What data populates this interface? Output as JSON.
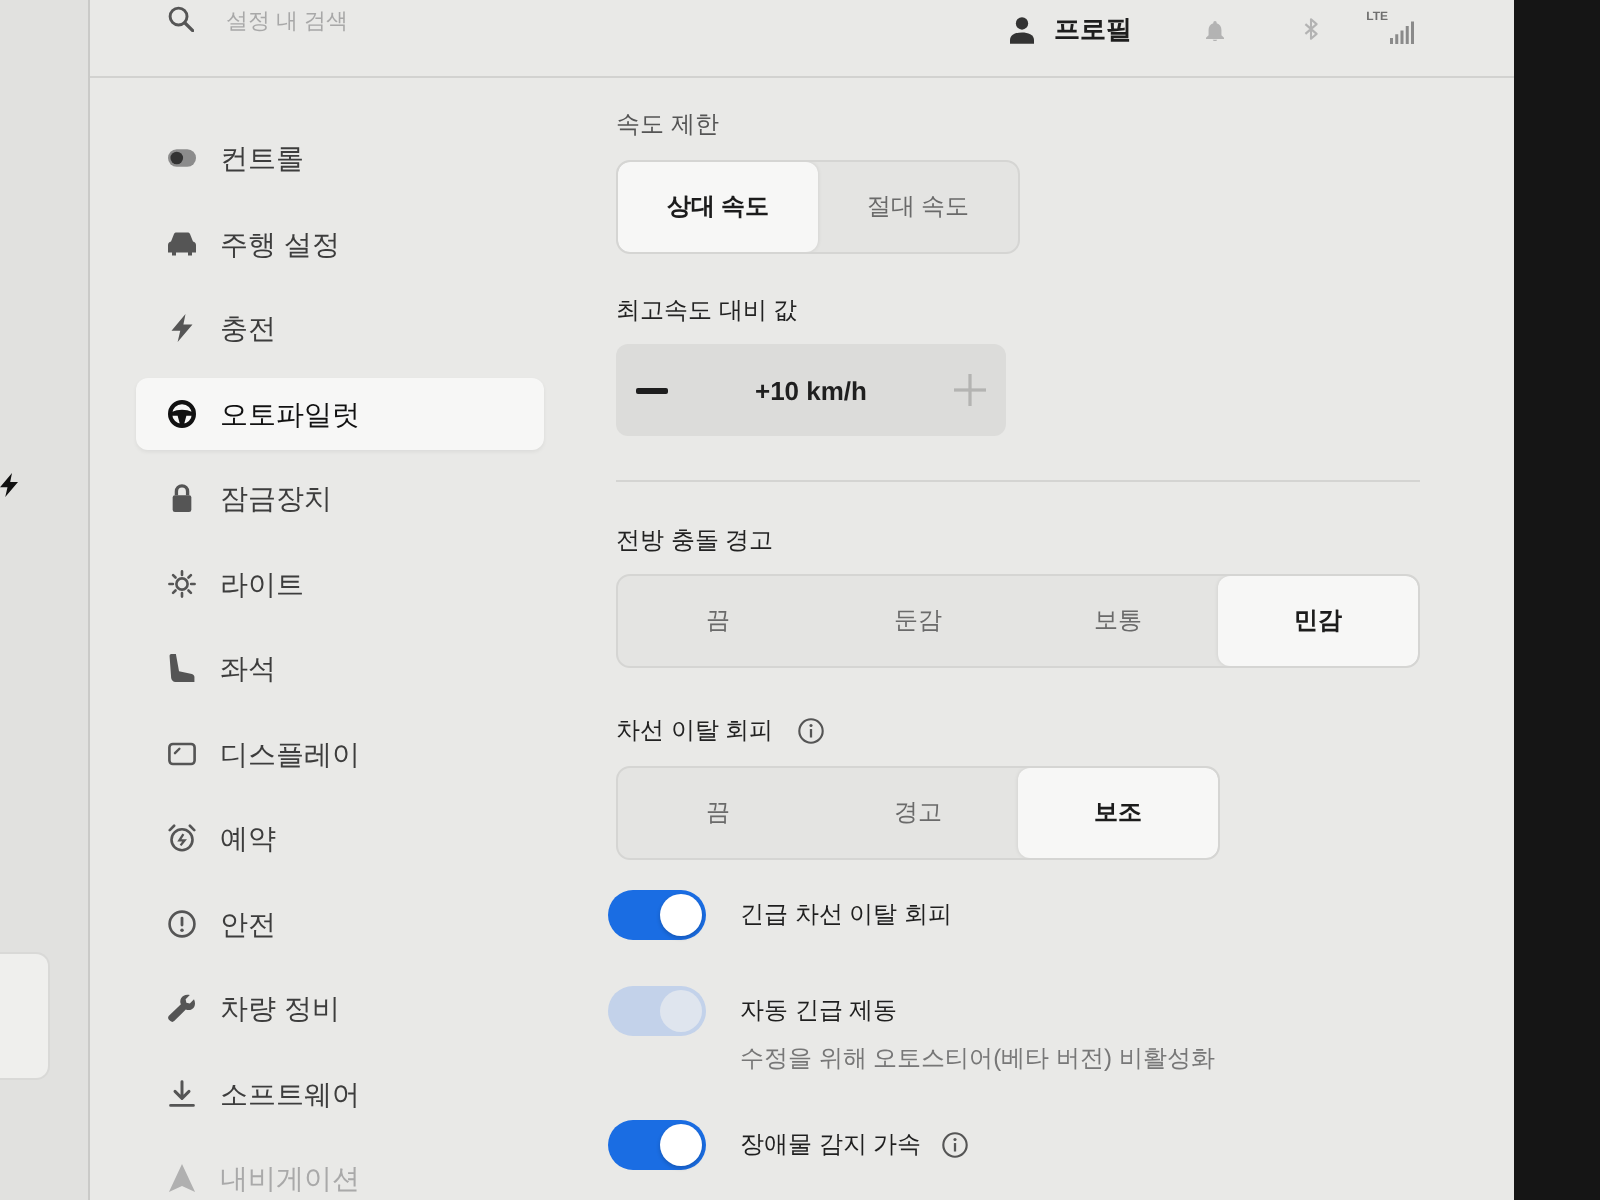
{
  "top_bar": {
    "search": {
      "placeholder": "설정 내 검색"
    },
    "profile": "프로필",
    "network": "LTE"
  },
  "sidebar": {
    "items": [
      {
        "kind": "controls",
        "label": "컨트롤",
        "selected": false
      },
      {
        "kind": "driving",
        "label": "주행 설정",
        "selected": false
      },
      {
        "kind": "charging",
        "label": "충전",
        "selected": false
      },
      {
        "kind": "autopilot",
        "label": "오토파일럿",
        "selected": true
      },
      {
        "kind": "locks",
        "label": "잠금장치",
        "selected": false
      },
      {
        "kind": "lights",
        "label": "라이트",
        "selected": false
      },
      {
        "kind": "seats",
        "label": "좌석",
        "selected": false
      },
      {
        "kind": "display",
        "label": "디스플레이",
        "selected": false
      },
      {
        "kind": "schedule",
        "label": "예약",
        "selected": false
      },
      {
        "kind": "safety",
        "label": "안전",
        "selected": false
      },
      {
        "kind": "service",
        "label": "차량 정비",
        "selected": false
      },
      {
        "kind": "software",
        "label": "소프트웨어",
        "selected": false
      },
      {
        "kind": "navigation",
        "label": "내비게이션",
        "selected": false
      }
    ]
  },
  "speed_limit": {
    "label": "속도 제한",
    "options": [
      {
        "label": "상대 속도",
        "selected": true
      },
      {
        "label": "절대 속도",
        "selected": false
      }
    ]
  },
  "speed_offset": {
    "label": "최고속도 대비 값",
    "value": "+10 km/h",
    "decrease_disabled": false,
    "increase_disabled": true
  },
  "forward_collision_warning": {
    "label": "전방 충돌 경고",
    "options": [
      {
        "label": "끔",
        "selected": false
      },
      {
        "label": "둔감",
        "selected": false
      },
      {
        "label": "보통",
        "selected": false
      },
      {
        "label": "민감",
        "selected": true
      }
    ]
  },
  "lane_departure_avoidance": {
    "label": "차선 이탈 회피",
    "info": true,
    "options": [
      {
        "label": "끔",
        "selected": false
      },
      {
        "label": "경고",
        "selected": false
      },
      {
        "label": "보조",
        "selected": true
      }
    ]
  },
  "toggles": [
    {
      "label": "긴급 차선 이탈 회피",
      "on": true,
      "disabled": false
    },
    {
      "label": "자동 긴급 제동",
      "on": true,
      "disabled": true,
      "note": "수정을 위해 오토스티어(베타 버전) 비활성화"
    },
    {
      "label": "장애물 감지 가속",
      "on": true,
      "disabled": false,
      "info": true
    }
  ]
}
